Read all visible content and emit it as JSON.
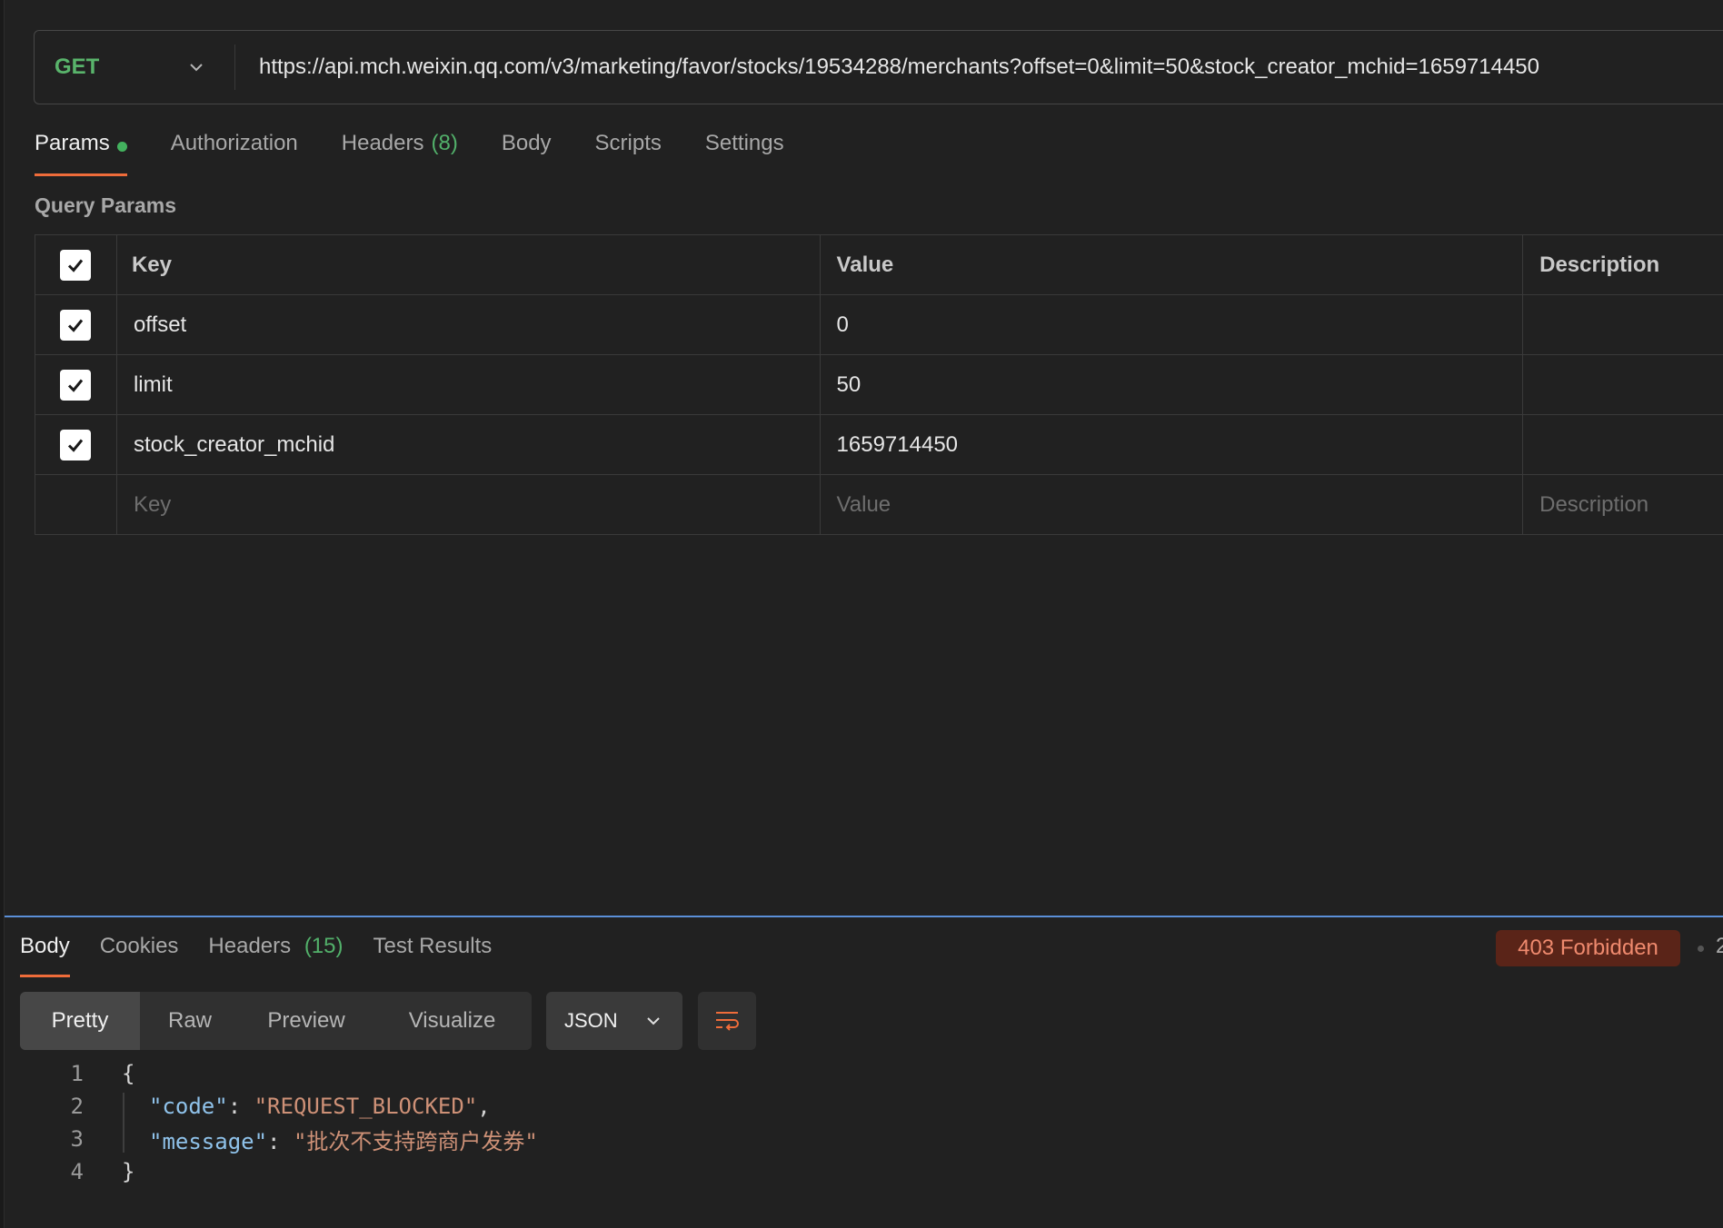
{
  "request": {
    "method": "GET",
    "url": "https://api.mch.weixin.qq.com/v3/marketing/favor/stocks/19534288/merchants?offset=0&limit=50&stock_creator_mchid=1659714450"
  },
  "request_tabs": {
    "params": "Params",
    "authorization": "Authorization",
    "headers": "Headers",
    "headers_count": "(8)",
    "body": "Body",
    "scripts": "Scripts",
    "settings": "Settings"
  },
  "query_params": {
    "title": "Query Params",
    "columns": {
      "key": "Key",
      "value": "Value",
      "description": "Description"
    },
    "rows": [
      {
        "key": "offset",
        "value": "0",
        "description": ""
      },
      {
        "key": "limit",
        "value": "50",
        "description": ""
      },
      {
        "key": "stock_creator_mchid",
        "value": "1659714450",
        "description": ""
      }
    ],
    "placeholders": {
      "key": "Key",
      "value": "Value",
      "description": "Description"
    }
  },
  "response_tabs": {
    "body": "Body",
    "cookies": "Cookies",
    "headers": "Headers",
    "headers_count": "(15)",
    "test_results": "Test Results"
  },
  "status": {
    "text": "403 Forbidden",
    "more": "2"
  },
  "viewer": {
    "modes": [
      "Pretty",
      "Raw",
      "Preview",
      "Visualize"
    ],
    "active_mode": "Pretty",
    "format": "JSON"
  },
  "response_body": {
    "line_numbers": [
      "1",
      "2",
      "3",
      "4"
    ],
    "open_brace": "{",
    "close_brace": "}",
    "code_key": "\"code\"",
    "code_value": "\"REQUEST_BLOCKED\"",
    "message_key": "\"message\"",
    "message_value": "\"批次不支持跨商户发券\""
  },
  "colors": {
    "method_get": "#59b46b",
    "active_tab_underline": "#ef6c3a",
    "status_bg": "#5a2418",
    "status_text": "#ef8a6e",
    "json_key": "#8fc2ea",
    "json_string": "#ce9177",
    "divider": "#5b8fd8"
  }
}
